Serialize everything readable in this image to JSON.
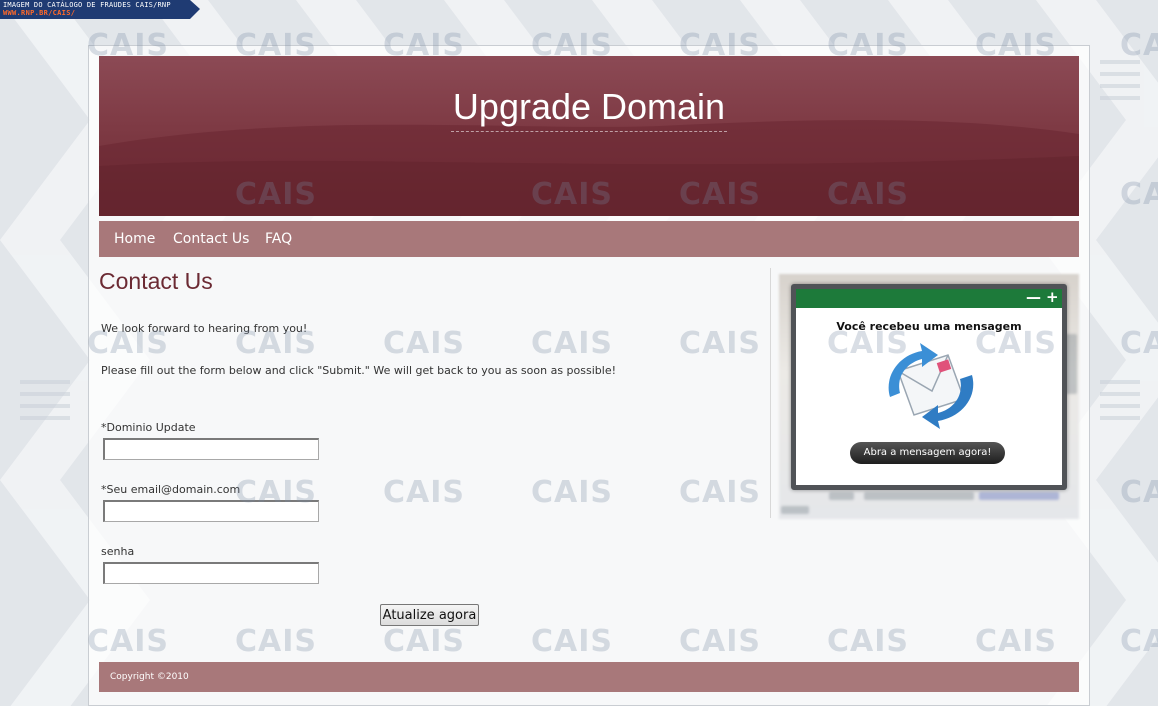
{
  "watermark": {
    "banner_line1": "IMAGEM DO CATÁLOGO DE FRAUDES CAIS/RNP",
    "banner_line2": "WWW.RNP.BR/CAIS/",
    "tile_text": "CAIS"
  },
  "header": {
    "title": "Upgrade Domain"
  },
  "nav": {
    "items": [
      "Home",
      "Contact Us",
      "FAQ"
    ]
  },
  "main": {
    "title": "Contact Us",
    "intro": "We look forward to hearing from you!",
    "instructions": "Please fill out the form below and click \"Submit.\" We will get back to you as soon as possible!",
    "fields": [
      {
        "label": "*Dominio Update",
        "value": ""
      },
      {
        "label": "*Seu email@domain.com",
        "value": ""
      },
      {
        "label": "senha",
        "value": ""
      }
    ],
    "submit_label": "Atualize agora"
  },
  "notification": {
    "minimize": "—",
    "maximize": "+",
    "heading": "Você recebeu uma mensagem",
    "button_label": "Abra a mensagem agora!"
  },
  "footer": {
    "copyright": "Copyright ©2010"
  },
  "colors": {
    "header_bg": "#7e3a44",
    "nav_bg": "#a8787a",
    "title_color": "#6b2a33",
    "notif_bar": "#1d7a3a"
  }
}
